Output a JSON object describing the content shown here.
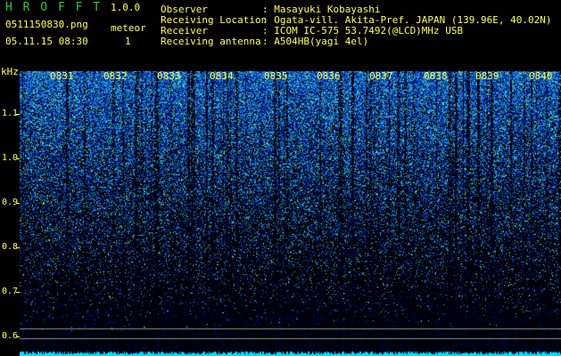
{
  "header": {
    "app_title": "H R O F F T",
    "version": "1.0.0",
    "filename": "0511150830.png",
    "datetime": "05.11.15 08:30",
    "meteor_label": "meteor",
    "meteor_count": "1"
  },
  "info": [
    {
      "key": "Observer",
      "value": ": Masayuki Kobayashi"
    },
    {
      "key": "Receiving Location",
      "value": ": Ogata-vill. Akita-Pref. JAPAN (139.96E, 40.02N)"
    },
    {
      "key": "Receiver",
      "value": ": ICOM IC-575 53.7492(@LCD)MHz USB"
    },
    {
      "key": "Receiving antenna",
      "value": ": A504HB(yagi 4el)"
    }
  ],
  "y_axis": {
    "unit": "kHz",
    "ticks": [
      "1.1",
      "1.0",
      "0.9",
      "0.8",
      "0.7",
      "0.6"
    ]
  },
  "x_axis": {
    "ticks": [
      "0831",
      "0832",
      "0833",
      "0834",
      "0835",
      "0836",
      "0837",
      "0838",
      "0839",
      "0840"
    ]
  },
  "colors": {
    "text": "#ffff55",
    "title": "#37c837",
    "background": "#000000",
    "signal": "#00e0ff"
  }
}
